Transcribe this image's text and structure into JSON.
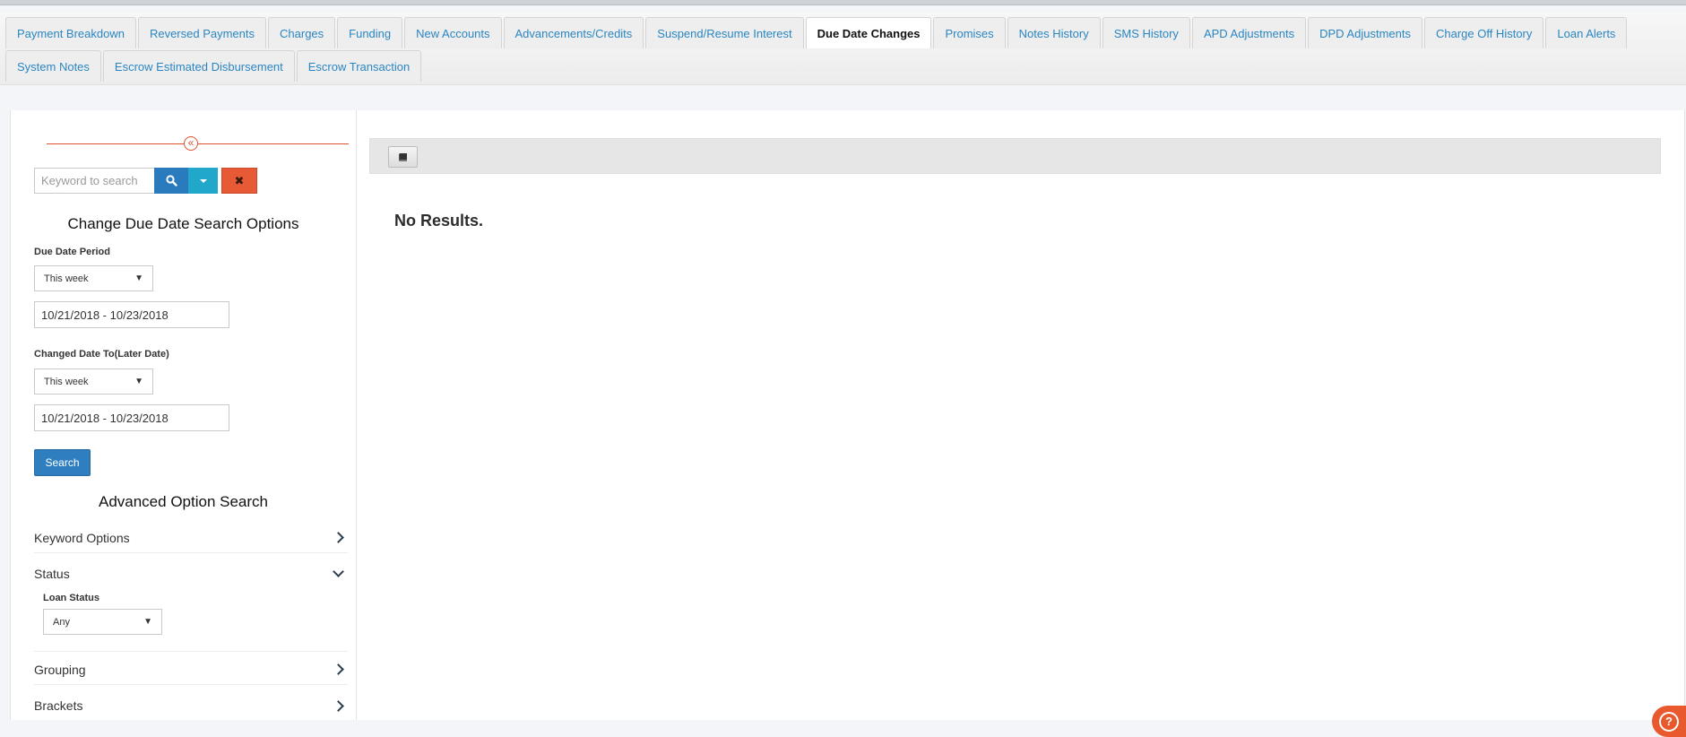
{
  "tabs": {
    "row1": [
      {
        "label": "Payment Breakdown",
        "active": false
      },
      {
        "label": "Reversed Payments",
        "active": false
      },
      {
        "label": "Charges",
        "active": false
      },
      {
        "label": "Funding",
        "active": false
      },
      {
        "label": "New Accounts",
        "active": false
      },
      {
        "label": "Advancements/Credits",
        "active": false
      },
      {
        "label": "Suspend/Resume Interest",
        "active": false
      },
      {
        "label": "Due Date Changes",
        "active": true
      },
      {
        "label": "Promises",
        "active": false
      },
      {
        "label": "Notes History",
        "active": false
      },
      {
        "label": "SMS History",
        "active": false
      },
      {
        "label": "APD Adjustments",
        "active": false
      },
      {
        "label": "DPD Adjustments",
        "active": false
      },
      {
        "label": "Charge Off History",
        "active": false
      },
      {
        "label": "Loan Alerts",
        "active": false
      }
    ],
    "row2": [
      {
        "label": "System Notes",
        "active": false
      },
      {
        "label": "Escrow Estimated Disbursement",
        "active": false
      },
      {
        "label": "Escrow Transaction",
        "active": false
      }
    ]
  },
  "sidebar": {
    "collapse_icon": "double-chevron-left-icon",
    "keyword": {
      "placeholder": "Keyword to search",
      "value": ""
    },
    "search_options_title": "Change Due Date Search Options",
    "due_date_period": {
      "label": "Due Date Period",
      "selected": "This week",
      "range": "10/21/2018 - 10/23/2018"
    },
    "changed_date_to": {
      "label": "Changed Date To(Later Date)",
      "selected": "This week",
      "range": "10/21/2018 - 10/23/2018"
    },
    "search_button": "Search",
    "advanced_title": "Advanced Option Search",
    "sections": {
      "keyword_options": "Keyword Options",
      "status": "Status",
      "grouping": "Grouping",
      "brackets": "Brackets"
    },
    "loan_status": {
      "label": "Loan Status",
      "selected": "Any"
    }
  },
  "main": {
    "toolbar_icon": "book-icon",
    "empty_message": "No Results."
  },
  "colors": {
    "accent": "#2a86c2",
    "primary_button": "#2f7fc0",
    "clear_button": "#e85a35",
    "help_button": "#e8592e"
  }
}
